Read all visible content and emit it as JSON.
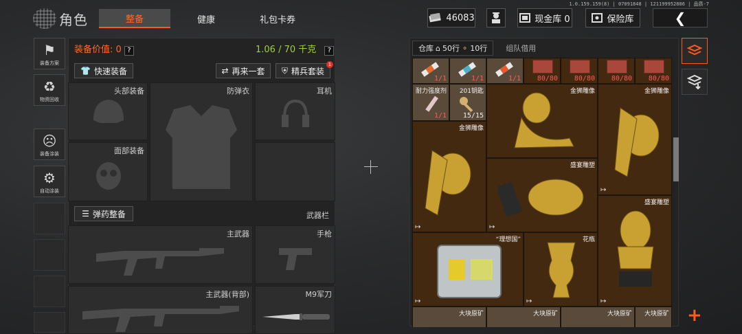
{
  "version": "1.0.159.159(8) | 07091848 | 121199952886 | 品质-7",
  "header": {
    "title": "角色",
    "tabs": [
      "整备",
      "健康",
      "礼包卡券"
    ],
    "currency": "46083",
    "cash_vault": "现金库 0",
    "safe_vault": "保险库",
    "accent": "#ff5a1e"
  },
  "left_menu": [
    "装备方案",
    "物资回收",
    "装备涂装",
    "自动涂装"
  ],
  "equipment": {
    "value_label": "装备价值: 0",
    "weight": "1.06 / 70 千克",
    "quick_equip": "快速装备",
    "again": "再来一套",
    "elite_kit": "精兵套装",
    "elite_badge": "1",
    "slots": {
      "head": "头部装备",
      "armor": "防弹衣",
      "earphone": "耳机",
      "face": "面部装备",
      "primary": "主武器",
      "pistol": "手枪",
      "primary_back": "主武器(背部)",
      "knife": "M9军刀",
      "weapon_bar": "武器栏"
    },
    "ammo_btn": "弹药整备"
  },
  "inventory": {
    "tab_label": "仓库",
    "rows": "50行",
    "keys": "10行",
    "team_borrow": "组队借用",
    "items": [
      {
        "name": "",
        "count": "1/1"
      },
      {
        "name": "",
        "count": "1/1"
      },
      {
        "name": "",
        "count": "1/1"
      },
      {
        "name": "",
        "count": "80/80"
      },
      {
        "name": "",
        "count": "80/80"
      },
      {
        "name": "",
        "count": "80/80"
      },
      {
        "name": "",
        "count": "80/80"
      },
      {
        "name": "耐力强度剂",
        "count": "1/1"
      },
      {
        "name": "201钥匙",
        "count": "15/15"
      },
      {
        "name": "金狮雕像",
        "count": ""
      },
      {
        "name": "金狮雕像",
        "count": ""
      },
      {
        "name": "金狮雕像",
        "count": ""
      },
      {
        "name": "盛宴雕塑",
        "count": ""
      },
      {
        "name": "盛宴雕塑",
        "count": ""
      },
      {
        "name": "“理想国”",
        "count": ""
      },
      {
        "name": "花瓶",
        "count": ""
      },
      {
        "name": "大块原矿",
        "count": ""
      },
      {
        "name": "大块原矿",
        "count": ""
      },
      {
        "name": "大块原矿",
        "count": ""
      },
      {
        "name": "大块原矿",
        "count": ""
      }
    ]
  }
}
